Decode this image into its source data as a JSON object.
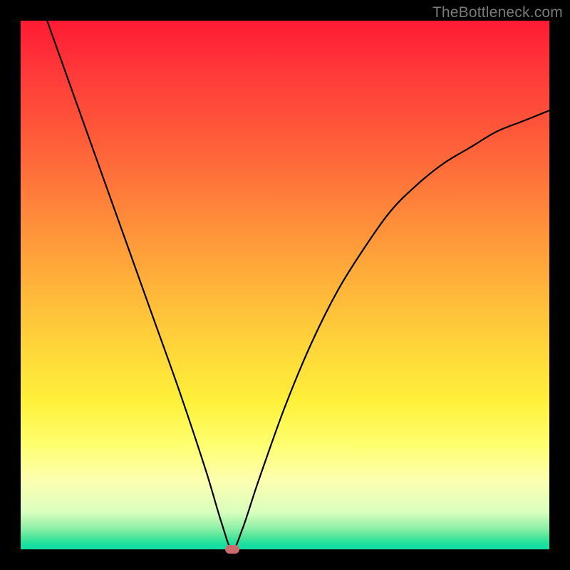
{
  "watermark": "TheBottleneck.com",
  "colors": {
    "frame": "#000000",
    "curve": "#000000",
    "marker": "#cc6b6b",
    "gradient_stops": [
      "#ff1a33",
      "#ff5b3a",
      "#ff9a3a",
      "#ffd63a",
      "#ffff6e",
      "#d9ffbe",
      "#42e39a",
      "#14dd9f"
    ]
  },
  "chart_data": {
    "type": "line",
    "title": "",
    "xlabel": "",
    "ylabel": "",
    "xlim": [
      0,
      100
    ],
    "ylim": [
      0,
      100
    ],
    "grid": false,
    "legend": false,
    "series": [
      {
        "name": "curve",
        "x": [
          5,
          10,
          15,
          20,
          25,
          30,
          35,
          38,
          40,
          42,
          45,
          50,
          55,
          60,
          65,
          70,
          75,
          80,
          85,
          90,
          95,
          100
        ],
        "y": [
          100,
          86,
          72,
          58,
          44,
          30,
          15,
          5,
          0,
          4,
          13,
          27,
          39,
          49,
          57,
          64,
          69,
          73,
          76,
          79,
          81,
          83
        ]
      }
    ],
    "marker": {
      "x": 40,
      "y": 0
    }
  }
}
